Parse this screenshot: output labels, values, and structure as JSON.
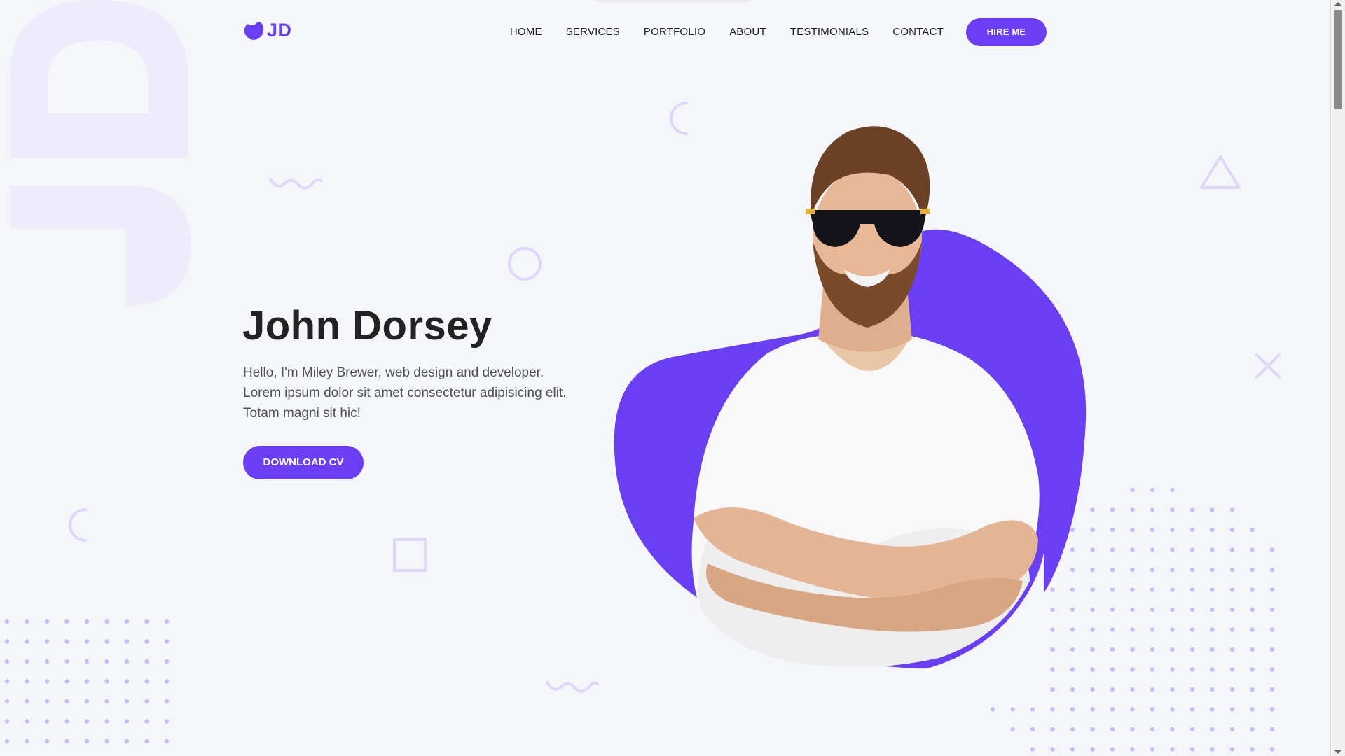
{
  "brand": {
    "logo_text": "JD",
    "watermark_text": "JD",
    "accent_color": "#6a3ff3"
  },
  "nav": {
    "items": [
      "HOME",
      "SERVICES",
      "PORTFOLIO",
      "ABOUT",
      "TESTIMONIALS",
      "CONTACT"
    ],
    "hire_label": "HIRE ME"
  },
  "hero": {
    "name": "John Dorsey",
    "description": "Hello, I'm Miley Brewer, web design and developer. Lorem ipsum dolor sit amet consectetur adipisicing elit. Totam magni sit hic!",
    "cta_label": "DOWNLOAD CV"
  },
  "icons": {
    "logo": "leaf-blob-icon",
    "decorations": [
      "arc-icon",
      "wave-icon",
      "circle-icon",
      "triangle-icon",
      "x-icon",
      "square-icon",
      "dot-grid-icon"
    ]
  }
}
